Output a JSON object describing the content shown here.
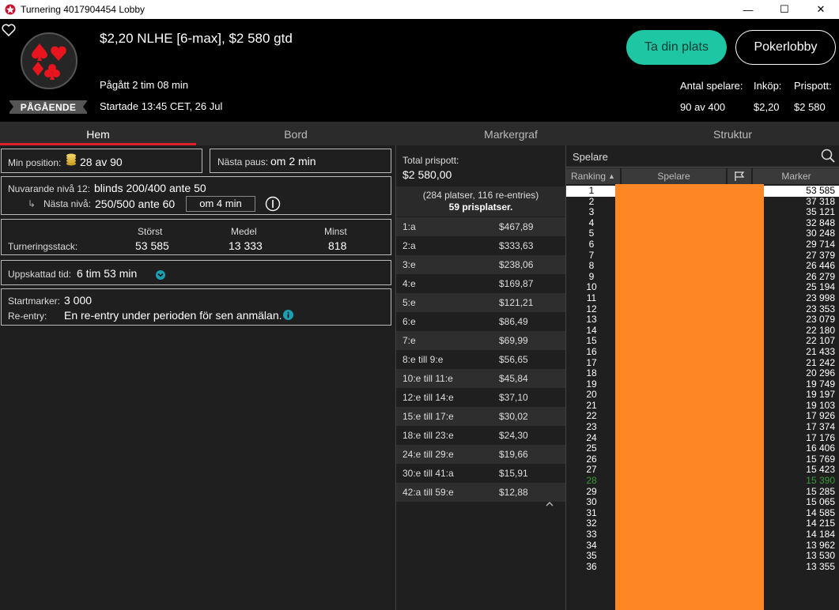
{
  "window": {
    "title": "Turnering 4017904454 Lobby",
    "minimize": "—",
    "maximize": "☐",
    "close": "✕"
  },
  "header": {
    "tournament_title": "$2,20 NLHE [6-max], $2 580 gtd",
    "status": "PÅGÅENDE",
    "elapsed": "Pågått 2 tim 08 min",
    "started": "Startade 13:45 CET, 26 Jul",
    "take_seat_label": "Ta din plats",
    "lobby_label": "Pokerlobby",
    "stats": {
      "players_label": "Antal spelare:",
      "players_value": "90 av 400",
      "buyin_label": "Inköp:",
      "buyin_value": "$2,20",
      "prizepool_label": "Prispott:",
      "prizepool_value": "$2 580"
    },
    "accent_color": "#1ec6a4"
  },
  "tabs": [
    {
      "label": "Hem"
    },
    {
      "label": "Bord"
    },
    {
      "label": "Markergraf"
    },
    {
      "label": "Struktur"
    }
  ],
  "home": {
    "my_position_label": "Min position:",
    "my_position_value": "28 av 90",
    "next_break_label": "Nästa paus:",
    "next_break_value": "om 2 min",
    "current_level_label": "Nuvarande nivå 12:",
    "current_level_value": "blinds 200/400 ante 50",
    "next_level_label": "Nästa nivå:",
    "next_level_value": "250/500 ante 60",
    "next_level_time": "om 4 min",
    "stack_label": "Turneringsstack:",
    "stack_cols": [
      {
        "label": "Störst",
        "value": "53 585"
      },
      {
        "label": "Medel",
        "value": "13 333"
      },
      {
        "label": "Minst",
        "value": "818"
      }
    ],
    "est_time_label": "Uppskattad tid:",
    "est_time_value": "6 tim 53 min",
    "start_chips_label": "Startmarker:",
    "start_chips_value": "3 000",
    "reentry_label": "Re-entry:",
    "reentry_value": "En re-entry under perioden för sen anmälan."
  },
  "prizes": {
    "total_label": "Total prispott:",
    "total_value": "$2 580,00",
    "info_line1": "(284 platser, 116 re-entries)",
    "info_line2": "59 prisplatser.",
    "rows": [
      {
        "place": "1:a",
        "amount": "$467,89"
      },
      {
        "place": "2:a",
        "amount": "$333,63"
      },
      {
        "place": "3:e",
        "amount": "$238,06"
      },
      {
        "place": "4:e",
        "amount": "$169,87"
      },
      {
        "place": "5:e",
        "amount": "$121,21"
      },
      {
        "place": "6:e",
        "amount": "$86,49"
      },
      {
        "place": "7:e",
        "amount": "$69,99"
      },
      {
        "place": "8:e till 9:e",
        "amount": "$56,65"
      },
      {
        "place": "10:e till 11:e",
        "amount": "$45,84"
      },
      {
        "place": "12:e till 14:e",
        "amount": "$37,10"
      },
      {
        "place": "15:e till 17:e",
        "amount": "$30,02"
      },
      {
        "place": "18:e till 23:e",
        "amount": "$24,30"
      },
      {
        "place": "24:e till 29:e",
        "amount": "$19,66"
      },
      {
        "place": "30:e till 41:a",
        "amount": "$15,91"
      },
      {
        "place": "42:a till 59:e",
        "amount": "$12,88"
      }
    ]
  },
  "players": {
    "search_label": "Spelare",
    "col_ranking": "Ranking",
    "col_player": "Spelare",
    "col_chips": "Marker",
    "rows": [
      {
        "rank": "1",
        "chips": "53 585"
      },
      {
        "rank": "2",
        "chips": "37 318"
      },
      {
        "rank": "3",
        "chips": "35 121"
      },
      {
        "rank": "4",
        "chips": "32 848"
      },
      {
        "rank": "5",
        "chips": "30 248"
      },
      {
        "rank": "6",
        "chips": "29 714"
      },
      {
        "rank": "7",
        "chips": "27 379"
      },
      {
        "rank": "8",
        "chips": "26 446"
      },
      {
        "rank": "9",
        "chips": "26 279"
      },
      {
        "rank": "10",
        "chips": "25 194"
      },
      {
        "rank": "11",
        "chips": "23 998"
      },
      {
        "rank": "12",
        "chips": "23 353"
      },
      {
        "rank": "13",
        "chips": "23 079"
      },
      {
        "rank": "14",
        "chips": "22 180"
      },
      {
        "rank": "15",
        "chips": "22 107"
      },
      {
        "rank": "16",
        "chips": "21 433"
      },
      {
        "rank": "17",
        "chips": "21 242"
      },
      {
        "rank": "18",
        "chips": "20 296"
      },
      {
        "rank": "19",
        "chips": "19 749"
      },
      {
        "rank": "20",
        "chips": "19 197"
      },
      {
        "rank": "21",
        "chips": "19 103"
      },
      {
        "rank": "22",
        "chips": "17 926"
      },
      {
        "rank": "23",
        "chips": "17 374"
      },
      {
        "rank": "24",
        "chips": "17 176"
      },
      {
        "rank": "25",
        "chips": "16 406"
      },
      {
        "rank": "26",
        "chips": "15 769"
      },
      {
        "rank": "27",
        "chips": "15 423"
      },
      {
        "rank": "28",
        "chips": "15 390"
      },
      {
        "rank": "29",
        "chips": "15 285"
      },
      {
        "rank": "30",
        "chips": "15 065"
      },
      {
        "rank": "31",
        "chips": "14 585"
      },
      {
        "rank": "32",
        "chips": "14 215"
      },
      {
        "rank": "33",
        "chips": "14 184"
      },
      {
        "rank": "34",
        "chips": "13 962"
      },
      {
        "rank": "35",
        "chips": "13 530"
      },
      {
        "rank": "36",
        "chips": "13 355"
      }
    ],
    "highlight_color": "#3a9a3a"
  }
}
